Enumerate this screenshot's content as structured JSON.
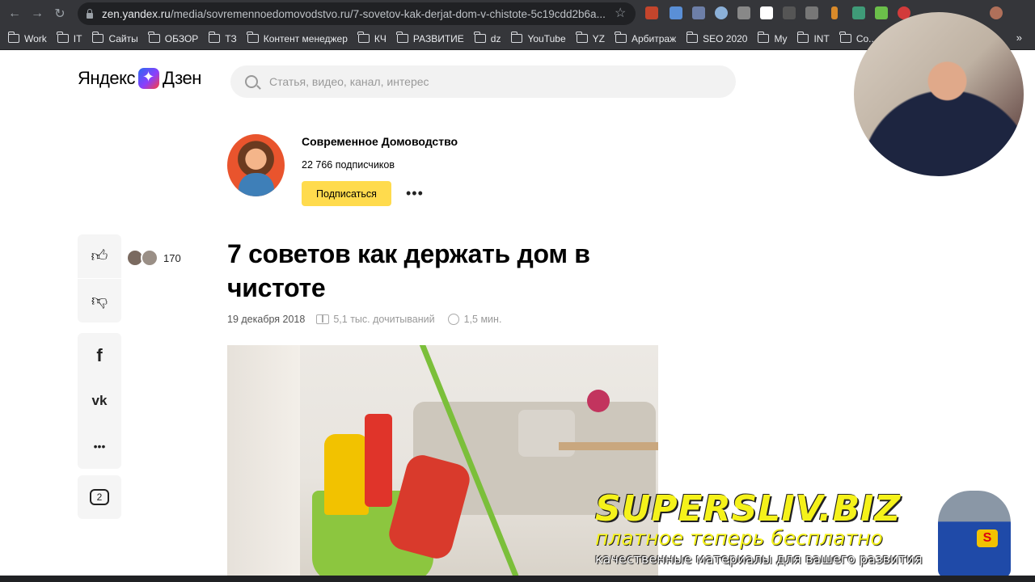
{
  "browser": {
    "url_host": "zen.yandex.ru",
    "url_path": "/media/sovremennoedomovodstvo.ru/7-sovetov-kak-derjat-dom-v-chistote-5c19cdd2b6a...",
    "bookmarks": [
      "Work",
      "IT",
      "Сайты",
      "ОБЗОР",
      "ТЗ",
      "Контент менеджер",
      "КЧ",
      "РАЗВИТИЕ",
      "dz",
      "YouTube",
      "YZ",
      "Арбитраж",
      "SEO 2020",
      "My",
      "INT",
      "Со..."
    ],
    "bookmarks_more": "»"
  },
  "header": {
    "logo_left": "Яндекс",
    "logo_right": "Дзен",
    "search_placeholder": "Статья, видео, канал, интерес"
  },
  "channel": {
    "name": "Современное Домоводство",
    "subscribers": "22 766 подписчиков",
    "subscribe_label": "Подписаться",
    "more": "•••"
  },
  "article": {
    "title": "7 советов как держать дом в чистоте",
    "date": "19 декабря 2018",
    "reads": "5,1 тыс. дочитываний",
    "read_time": "1,5 мин."
  },
  "sidebar": {
    "like_count": "170",
    "comments_count": "2",
    "share_more": "•••"
  },
  "watermark": {
    "title": "SUPERSLIV.BIZ",
    "subtitle": "платное теперь бесплатно",
    "tagline": "качественные материалы для вашего развития"
  }
}
